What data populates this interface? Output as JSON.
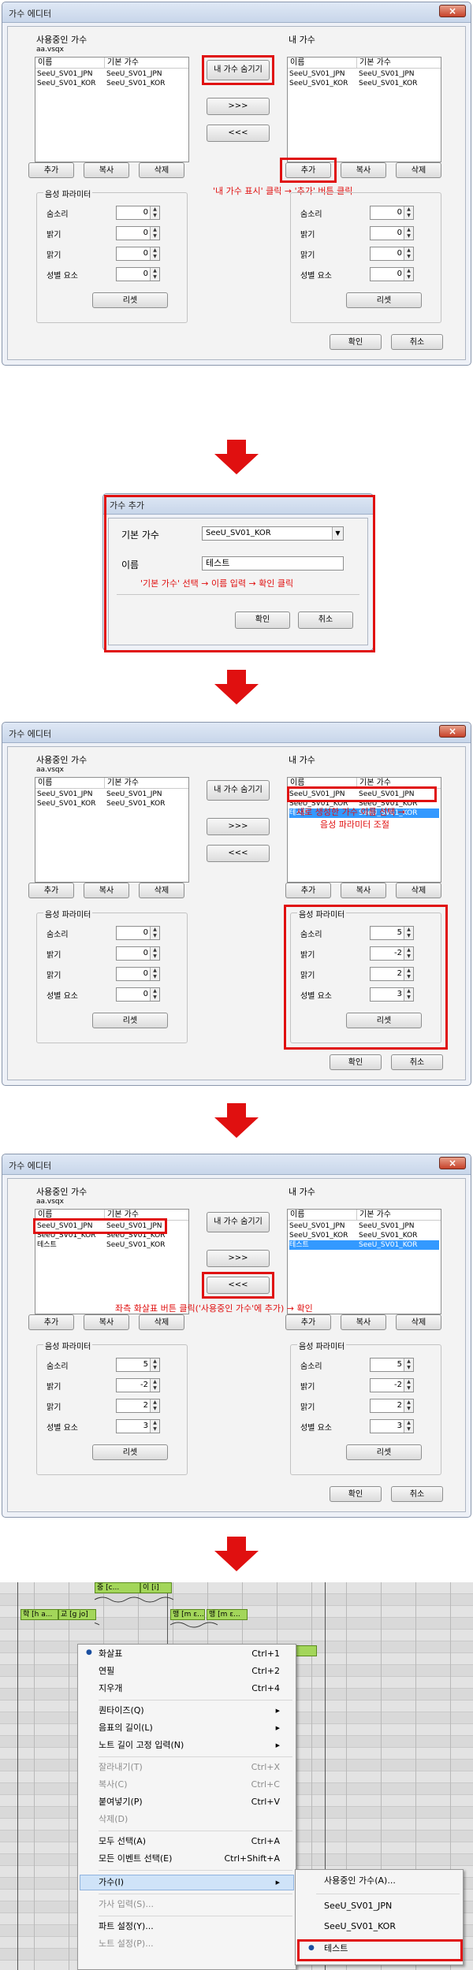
{
  "editor1": {
    "title": "가수 에디터",
    "close": "×",
    "used_label": "사용중인 가수",
    "project": "aa.vsqx",
    "my_label": "내 가수",
    "col_name": "이름",
    "col_base": "기본 가수",
    "used_rows": [
      [
        "SeeU_SV01_JPN",
        "SeeU_SV01_JPN"
      ],
      [
        "SeeU_SV01_KOR",
        "SeeU_SV01_KOR"
      ]
    ],
    "my_rows": [
      [
        "SeeU_SV01_JPN",
        "SeeU_SV01_JPN"
      ],
      [
        "SeeU_SV01_KOR",
        "SeeU_SV01_KOR"
      ]
    ],
    "toggle_btn": "내 가수 숨기기",
    "right_btn": ">>>",
    "left_btn": "<<<",
    "add": "추가",
    "copy": "복사",
    "delete": "삭제",
    "note": "'내 가수 표시' 클릭 → '추가' 버튼 클릭",
    "param_label": "음성 파라미터",
    "params": [
      "숨소리",
      "밝기",
      "맑기",
      "성별 요소"
    ],
    "values_left": [
      "0",
      "0",
      "0",
      "0"
    ],
    "values_right": [
      "0",
      "0",
      "0",
      "0"
    ],
    "reset": "리셋",
    "ok": "확인",
    "cancel": "취소"
  },
  "add_dialog": {
    "title": "가수 추가",
    "base_label": "기본 가수",
    "base_value": "SeeU_SV01_KOR",
    "name_label": "이름",
    "name_value": "테스트",
    "note": "'기본 가수' 선택 → 이름 입력 → 확인 클릭",
    "ok": "확인",
    "cancel": "취소"
  },
  "editor2": {
    "title": "가수 에디터",
    "my_rows": [
      [
        "SeeU_SV01_JPN",
        "SeeU_SV01_JPN"
      ],
      [
        "SeeU_SV01_KOR",
        "SeeU_SV01_KOR"
      ],
      [
        "테스트",
        "SeeU_SV01_KOR"
      ]
    ],
    "note_line1": "새로 생성한 가수 이름 선택 →",
    "note_line2": "음성 파라미터 조절",
    "values_right": [
      "5",
      "-2",
      "2",
      "3"
    ]
  },
  "editor3": {
    "title": "가수 에디터",
    "used_rows": [
      [
        "SeeU_SV01_JPN",
        "SeeU_SV01_JPN"
      ],
      [
        "SeeU_SV01_KOR",
        "SeeU_SV01_KOR"
      ],
      [
        "테스트",
        "SeeU_SV01_KOR"
      ]
    ],
    "my_rows": [
      [
        "SeeU_SV01_JPN",
        "SeeU_SV01_JPN"
      ],
      [
        "SeeU_SV01_KOR",
        "SeeU_SV01_KOR"
      ],
      [
        "테스트",
        "SeeU_SV01_KOR"
      ]
    ],
    "note": "좌측 화살표 버튼 클릭('사용중인 가수'에 추가) → 확인",
    "values": [
      "5",
      "-2",
      "2",
      "3"
    ]
  },
  "piano": {
    "notes": [
      "중 [c...",
      "이 [i]",
      "학 [h a...",
      "교 [g jo]",
      "맹 [m ɛ...",
      "맹 [m ɛ..."
    ]
  },
  "context_menu": {
    "items": [
      {
        "label": "화살표",
        "key": "Ctrl+1"
      },
      {
        "label": "연필",
        "key": "Ctrl+2"
      },
      {
        "label": "지우개",
        "key": "Ctrl+4"
      },
      {
        "label": "퀀타이즈(Q)",
        "key": "▶"
      },
      {
        "label": "음표의 길이(L)",
        "key": "▶"
      },
      {
        "label": "노트 길이 고정 입력(N)",
        "key": "▶"
      },
      {
        "label": "잘라내기(T)",
        "key": "Ctrl+X"
      },
      {
        "label": "복사(C)",
        "key": "Ctrl+C"
      },
      {
        "label": "붙여넣기(P)",
        "key": "Ctrl+V"
      },
      {
        "label": "삭제(D)",
        "key": ""
      },
      {
        "label": "모두 선택(A)",
        "key": "Ctrl+A"
      },
      {
        "label": "모든 이벤트 선택(E)",
        "key": "Ctrl+Shift+A"
      },
      {
        "label": "가수(I)",
        "key": "▶"
      },
      {
        "label": "가사 입력(S)...",
        "key": ""
      },
      {
        "label": "파트 설정(Y)...",
        "key": ""
      },
      {
        "label": "노트 설정(P)...",
        "key": ""
      }
    ],
    "submenu": [
      "사용중인 가수(A)...",
      "SeeU_SV01_JPN",
      "SeeU_SV01_KOR",
      "테스트"
    ],
    "bullet": "●"
  }
}
